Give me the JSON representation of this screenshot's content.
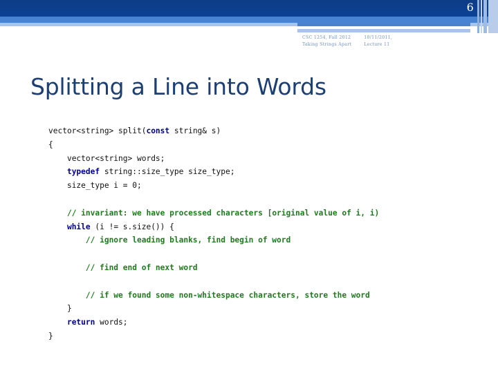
{
  "slide": {
    "page_number": "6",
    "title": "Splitting a Line into Words",
    "header_meta": {
      "left": {
        "line1": "CSC 1254, Fall 2012",
        "line2": "Taking Strings Apart"
      },
      "right": {
        "line1": "10/11/2011,",
        "line2": "Lecture 11"
      }
    }
  },
  "colors": {
    "banner_dark": "#0c3f8f",
    "banner_mid": "#4782d3",
    "banner_light": "#a8c4e8",
    "title": "#1b3f72",
    "meta_text": "#6e8fc4",
    "code_plain": "#111111",
    "code_keyword": "#00008f",
    "code_comment": "#1f7a1f"
  },
  "code": {
    "language": "cpp",
    "lines": [
      {
        "indent": 0,
        "tokens": [
          {
            "t": "plain",
            "s": "vector<string> split("
          },
          {
            "t": "keyword",
            "s": "const"
          },
          {
            "t": "plain",
            "s": " string& s)"
          }
        ]
      },
      {
        "indent": 0,
        "tokens": [
          {
            "t": "plain",
            "s": "{"
          }
        ]
      },
      {
        "indent": 1,
        "tokens": [
          {
            "t": "plain",
            "s": "vector<string> words;"
          }
        ]
      },
      {
        "indent": 1,
        "tokens": [
          {
            "t": "keyword",
            "s": "typedef"
          },
          {
            "t": "plain",
            "s": " string::size_type size_type;"
          }
        ]
      },
      {
        "indent": 1,
        "tokens": [
          {
            "t": "plain",
            "s": "size_type i = 0;"
          }
        ]
      },
      {
        "indent": 0,
        "tokens": []
      },
      {
        "indent": 1,
        "tokens": [
          {
            "t": "comment",
            "s": "// invariant: we have processed characters [original value of i, i)"
          }
        ]
      },
      {
        "indent": 1,
        "tokens": [
          {
            "t": "keyword",
            "s": "while"
          },
          {
            "t": "plain",
            "s": " (i != s.size()) {"
          }
        ]
      },
      {
        "indent": 2,
        "tokens": [
          {
            "t": "comment",
            "s": "// ignore leading blanks, find begin of word"
          }
        ]
      },
      {
        "indent": 0,
        "tokens": []
      },
      {
        "indent": 2,
        "tokens": [
          {
            "t": "comment",
            "s": "// find end of next word"
          }
        ]
      },
      {
        "indent": 0,
        "tokens": []
      },
      {
        "indent": 2,
        "tokens": [
          {
            "t": "comment",
            "s": "// if we found some non-whitespace characters, store the word"
          }
        ]
      },
      {
        "indent": 1,
        "tokens": [
          {
            "t": "plain",
            "s": "}"
          }
        ]
      },
      {
        "indent": 1,
        "tokens": [
          {
            "t": "keyword",
            "s": "return"
          },
          {
            "t": "plain",
            "s": " words;"
          }
        ]
      },
      {
        "indent": 0,
        "tokens": [
          {
            "t": "plain",
            "s": "}"
          }
        ]
      }
    ]
  }
}
